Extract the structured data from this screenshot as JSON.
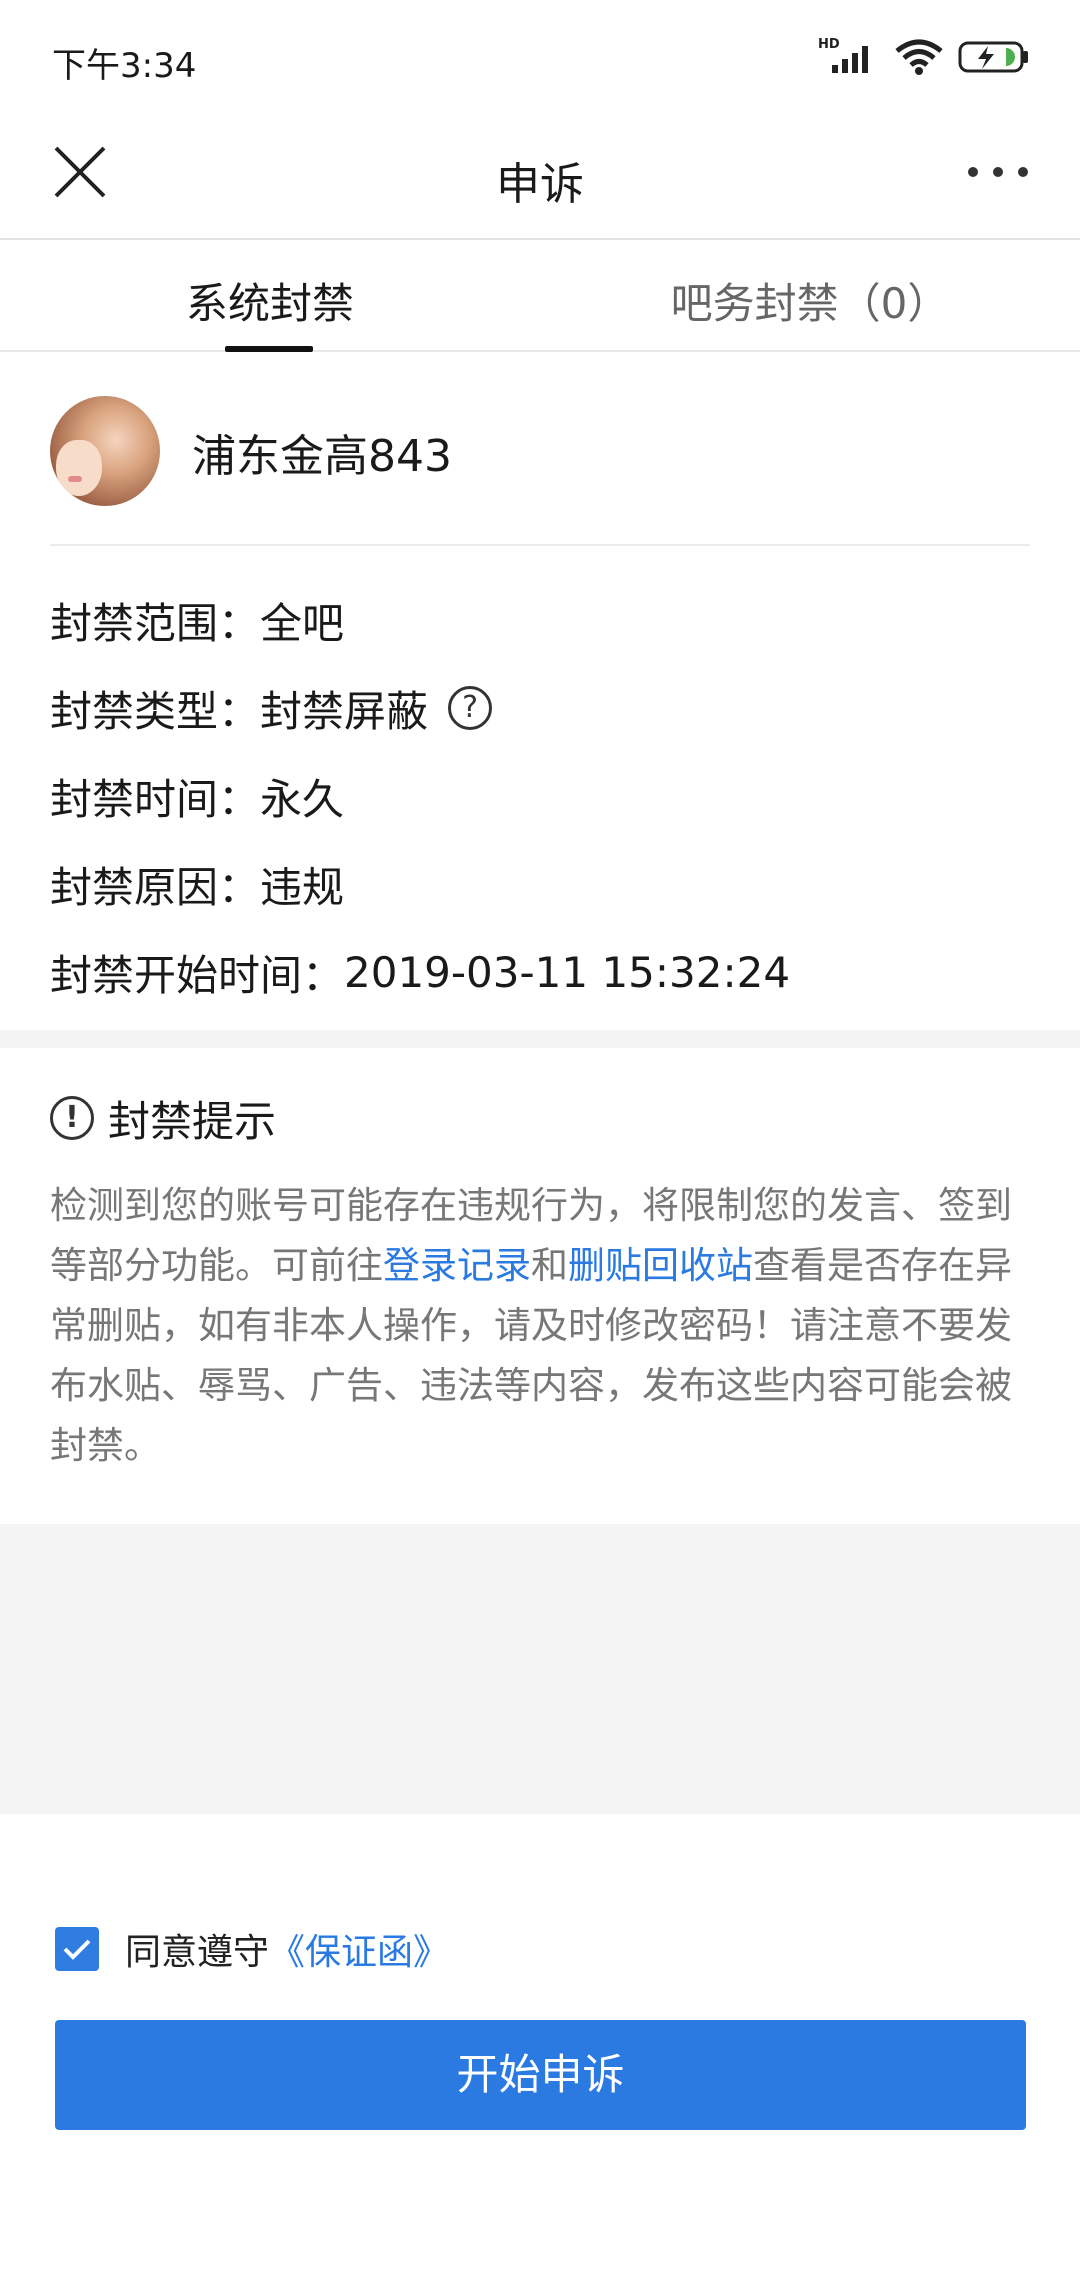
{
  "status_bar": {
    "time": "下午3:34",
    "network_label": "HD",
    "battery_color": "#4caf50"
  },
  "nav": {
    "title": "申诉",
    "close_icon": "close-icon",
    "more_icon": "more-icon"
  },
  "tabs": [
    {
      "label": "系统封禁",
      "active": true
    },
    {
      "label": "吧务封禁（0）",
      "active": false
    }
  ],
  "user": {
    "name": "浦东金高843",
    "avatar_icon": "avatar"
  },
  "ban_info": {
    "scope": {
      "label": "封禁范围：",
      "value": "全吧"
    },
    "type": {
      "label": "封禁类型：",
      "value": "封禁屏蔽",
      "help_icon": "?"
    },
    "duration": {
      "label": "封禁时间：",
      "value": "永久"
    },
    "reason": {
      "label": "封禁原因：",
      "value": "违规"
    },
    "start": {
      "label": "封禁开始时间：",
      "value": "2019-03-11 15:32:24"
    }
  },
  "notice": {
    "icon_glyph": "!",
    "title": "封禁提示",
    "text_1": "检测到您的账号可能存在违规行为，将限制您的发言、签到等部分功能。可前往",
    "link_login": "登录记录",
    "text_2": "和",
    "link_recycle": "删贴回收站",
    "text_3": "查看是否存在异常删贴，如有非本人操作，请及时修改密码！请注意不要发布水贴、辱骂、广告、违法等内容，发布这些内容可能会被封禁。"
  },
  "agreement": {
    "checked": true,
    "text": "同意遵守",
    "link": "《保证函》"
  },
  "button": {
    "label": "开始申诉"
  },
  "colors": {
    "accent": "#2a7ae2",
    "checkbox": "#2f7de1",
    "background_gray": "#f4f4f4"
  }
}
